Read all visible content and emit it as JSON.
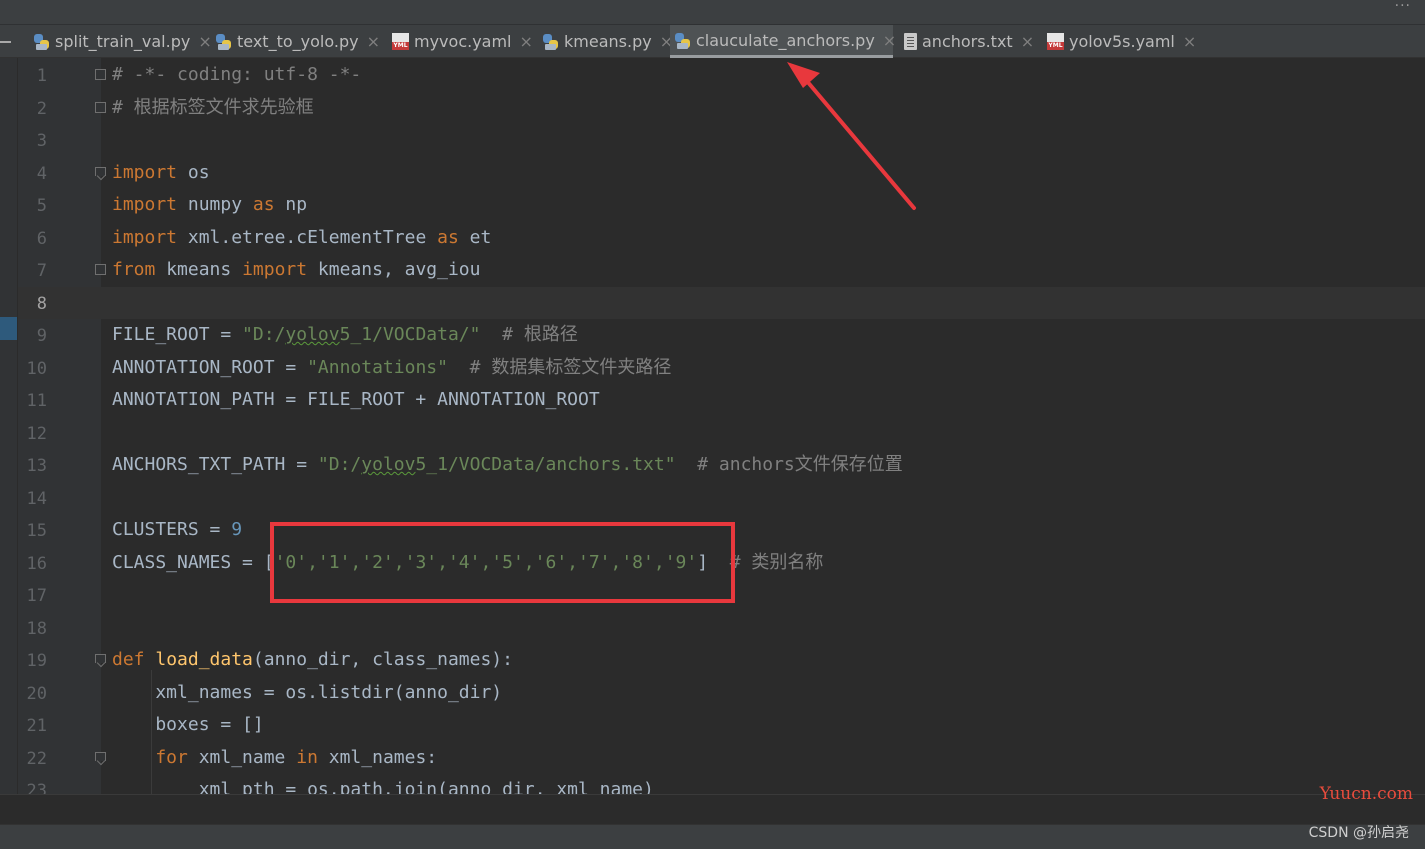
{
  "tabs": [
    {
      "label": "split_train_val.py",
      "icon": "python-file-icon",
      "active": false
    },
    {
      "label": "text_to_yolo.py",
      "icon": "python-file-icon",
      "active": false
    },
    {
      "label": "myvoc.yaml",
      "icon": "yaml-file-icon",
      "active": false
    },
    {
      "label": "kmeans.py",
      "icon": "python-file-icon",
      "active": false
    },
    {
      "label": "clauculate_anchors.py",
      "icon": "python-file-icon",
      "active": true
    },
    {
      "label": "anchors.txt",
      "icon": "text-file-icon",
      "active": false
    },
    {
      "label": "yolov5s.yaml",
      "icon": "yaml-file-icon",
      "active": false
    }
  ],
  "tab_close_glyph": "×",
  "editor": {
    "current_line": 8,
    "line_numbers": [
      "1",
      "2",
      "3",
      "4",
      "5",
      "6",
      "7",
      "8",
      "9",
      "10",
      "11",
      "12",
      "13",
      "14",
      "15",
      "16",
      "17",
      "18",
      "19",
      "20",
      "21",
      "22",
      "23"
    ],
    "code": {
      "l1": "# -*- coding: utf-8 -*-",
      "l2": "# 根据标签文件求先验框",
      "l4_kw": "import",
      "l4_rest": " os",
      "l5_kw": "import",
      "l5_a": " numpy ",
      "l5_as": "as",
      "l5_b": " np",
      "l6_kw": "import",
      "l6_a": " xml.etree.cElementTree ",
      "l6_as": "as",
      "l6_b": " et",
      "l7_from": "from",
      "l7_a": " kmeans ",
      "l7_import": "import",
      "l7_b": " kmeans, avg_iou",
      "l9_a": "FILE_ROOT = ",
      "l9_s1": "\"D:/",
      "l9_s2": "yolov",
      "l9_s3": "5_1/VOCData/\"",
      "l9_com": "  # 根路径",
      "l10_a": "ANNOTATION_ROOT = ",
      "l10_s": "\"Annotations\"",
      "l10_com": "  # 数据集标签文件夹路径",
      "l11": "ANNOTATION_PATH = FILE_ROOT + ANNOTATION_ROOT",
      "l13_a": "ANCHORS_TXT_PATH = ",
      "l13_s1": "\"D:/",
      "l13_s2": "yolov",
      "l13_s3": "5_1/VOCData/anchors.txt\"",
      "l13_com": "  # anchors文件保存位置",
      "l15_a": "CLUSTERS = ",
      "l15_n": "9",
      "l16_a": "CLASS_NAMES = [",
      "l16_s": "'0','1','2','3','4','5','6','7','8','9'",
      "l16_b": "]",
      "l16_com": "  # 类别名称",
      "l19_def": "def",
      "l19_fn": " load_data",
      "l19_rest": "(anno_dir, class_names):",
      "l20": "    xml_names = os.listdir(anno_dir)",
      "l21": "    boxes = []",
      "l22_kw": "    for",
      "l22_a": " xml_name ",
      "l22_in": "in",
      "l22_b": " xml_names:",
      "l23": "        xml_pth = os.path.join(anno_dir, xml_name)"
    }
  },
  "annotation": {
    "box_color": "#e8383d",
    "arrow_color": "#e8383d"
  },
  "watermarks": {
    "site": "Yuucn.com",
    "author": "CSDN @孙启尧"
  }
}
